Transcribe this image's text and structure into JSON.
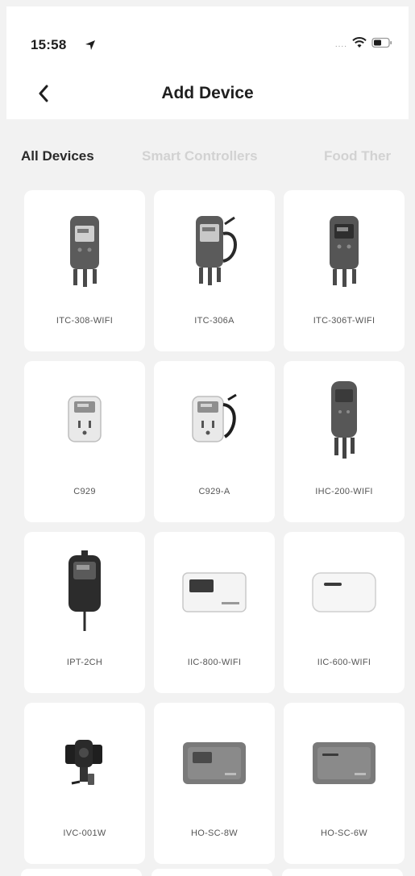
{
  "status_bar": {
    "time": "15:58",
    "signal_dots": "....",
    "icons": [
      "location-arrow-icon",
      "wifi-icon",
      "battery-icon"
    ]
  },
  "nav": {
    "title": "Add Device",
    "back_icon": "chevron-left-icon"
  },
  "tabs": [
    {
      "label": "All Devices",
      "active": true
    },
    {
      "label": "Smart Controllers",
      "active": false
    },
    {
      "label": "Food Ther",
      "active": false
    }
  ],
  "devices": [
    {
      "name": "ITC-308-WIFI",
      "icon": "thermostat-controller-icon"
    },
    {
      "name": "ITC-306A",
      "icon": "thermostat-controller-probe-icon"
    },
    {
      "name": "ITC-306T-WIFI",
      "icon": "thermostat-controller-icon"
    },
    {
      "name": "C929",
      "icon": "smart-plug-icon"
    },
    {
      "name": "C929-A",
      "icon": "smart-plug-probe-icon"
    },
    {
      "name": "IHC-200-WIFI",
      "icon": "humidity-controller-icon"
    },
    {
      "name": "IPT-2CH",
      "icon": "plug-timer-icon"
    },
    {
      "name": "IIC-800-WIFI",
      "icon": "irrigation-controller-icon"
    },
    {
      "name": "IIC-600-WIFI",
      "icon": "irrigation-controller-icon"
    },
    {
      "name": "IVC-001W",
      "icon": "inline-fan-icon"
    },
    {
      "name": "HO-SC-8W",
      "icon": "sprinkler-controller-icon"
    },
    {
      "name": "HO-SC-6W",
      "icon": "sprinkler-controller-icon"
    }
  ],
  "colors": {
    "background": "#f2f2f2",
    "card": "#ffffff",
    "title_text": "#1f1f1f",
    "inactive_tab": "#d2d2d2"
  }
}
